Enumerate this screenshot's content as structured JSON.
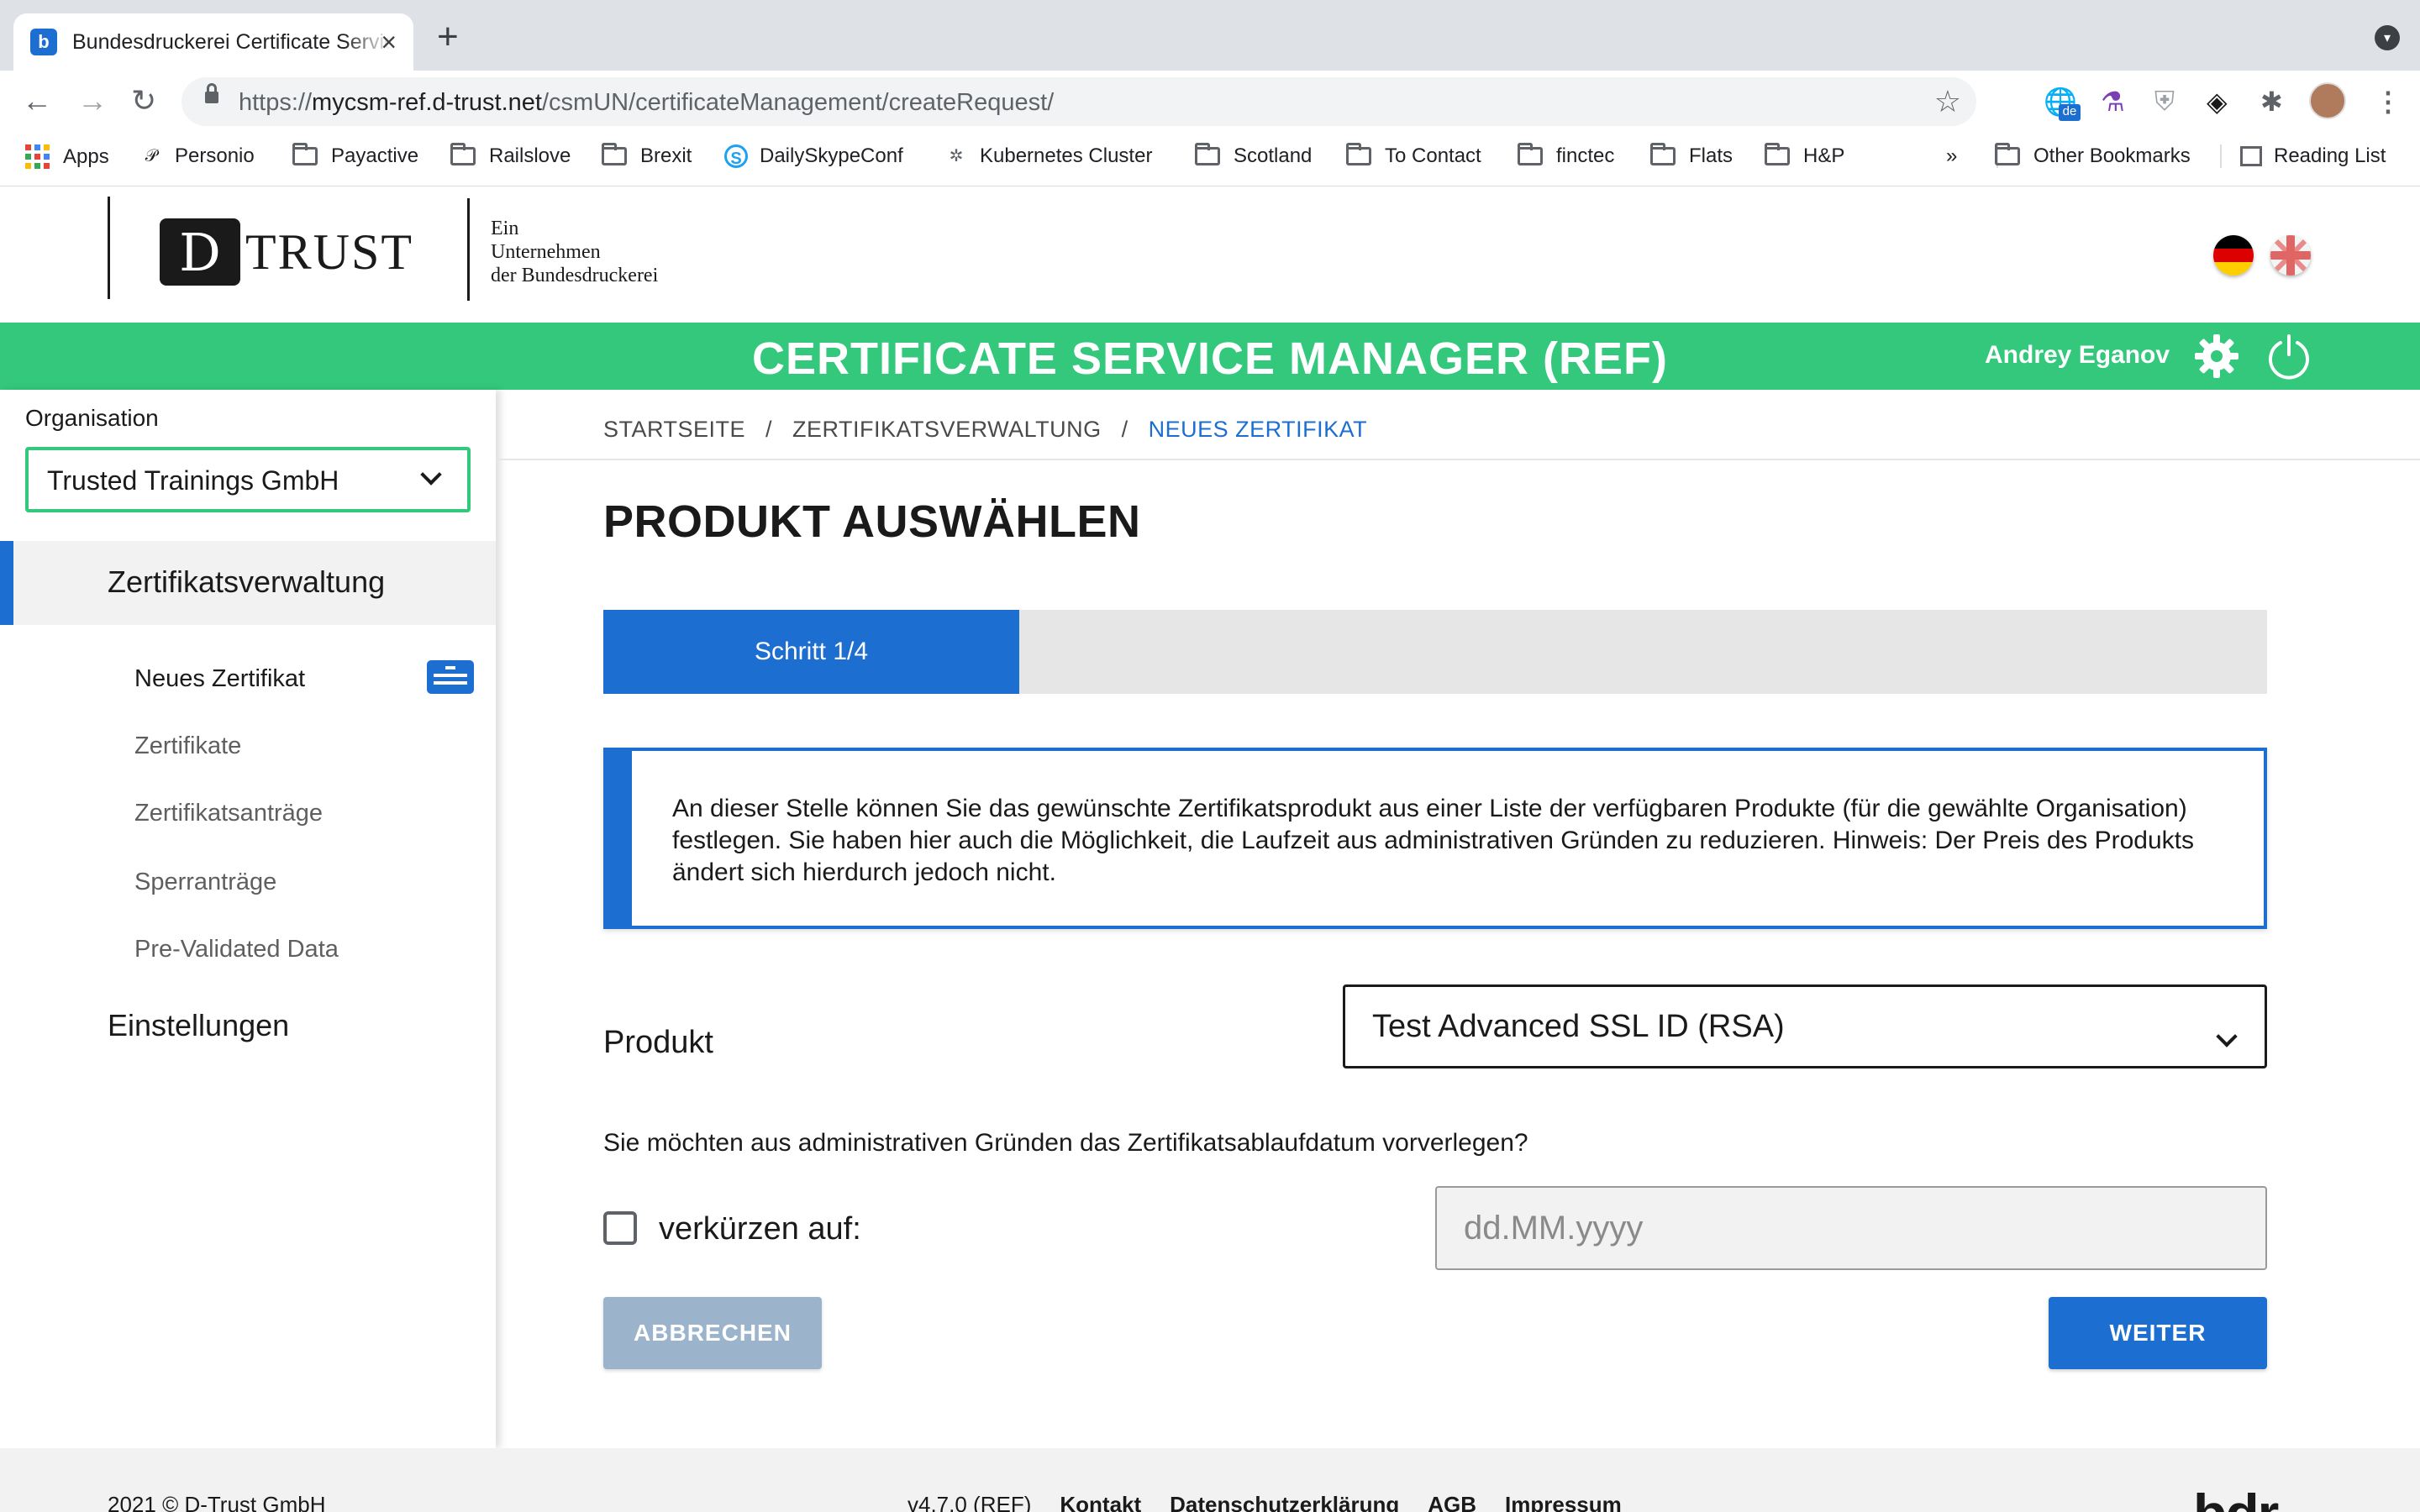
{
  "browser": {
    "tab_title": "Bundesdruckerei Certificate Service Manager",
    "favicon_letter": "b",
    "url_prefix": "https://",
    "url_host": "mycsm-ref.d-trust.net",
    "url_path": "/csmUN/certificateManagement/createRequest/",
    "profile_lang_badge": "de",
    "bookmarks": [
      {
        "label": "Apps",
        "icon": "apps-grid-icon"
      },
      {
        "label": "Personio",
        "icon": "personio-icon"
      },
      {
        "label": "Payactive",
        "icon": "folder-icon"
      },
      {
        "label": "Railslove",
        "icon": "folder-icon"
      },
      {
        "label": "Brexit",
        "icon": "folder-icon"
      },
      {
        "label": "DailySkypeConf",
        "icon": "skype-icon"
      },
      {
        "label": "Kubernetes Cluster",
        "icon": "kubernetes-icon"
      },
      {
        "label": "Scotland",
        "icon": "folder-icon"
      },
      {
        "label": "To Contact",
        "icon": "folder-icon"
      },
      {
        "label": "finctec",
        "icon": "folder-icon"
      },
      {
        "label": "Flats",
        "icon": "folder-icon"
      },
      {
        "label": "H&P",
        "icon": "folder-icon"
      }
    ],
    "bookmarks_overflow": "»",
    "other_bookmarks": "Other Bookmarks",
    "reading_list": "Reading List"
  },
  "header": {
    "logo_mark": "D",
    "logo_text": "TRUST",
    "logo_sub_1": "Ein",
    "logo_sub_2": "Unternehmen",
    "logo_sub_3": "der Bundesdruckerei",
    "languages": [
      "de",
      "en"
    ]
  },
  "banner": {
    "title": "CERTIFICATE SERVICE MANAGER (REF)",
    "user_name": "Andrey Eganov",
    "color": "#33c87c"
  },
  "sidebar": {
    "org_label": "Organisation",
    "org_value": "Trusted Trainings GmbH",
    "main_item": "Zertifikatsverwaltung",
    "sub_items": [
      {
        "label": "Neues Zertifikat",
        "active": true
      },
      {
        "label": "Zertifikate"
      },
      {
        "label": "Zertifikatsanträge"
      },
      {
        "label": "Sperranträge"
      },
      {
        "label": "Pre-Validated Data"
      }
    ],
    "settings": "Einstellungen"
  },
  "breadcrumb": [
    "STARTSEITE",
    "ZERTIFIKATSVERWALTUNG",
    "NEUES ZERTIFIKAT"
  ],
  "breadcrumb_separator": "/",
  "main": {
    "title": "PRODUKT AUSWÄHLEN",
    "step_label": "Schritt 1/4",
    "step_progress": 0.25,
    "info_text": "An dieser Stelle können Sie das gewünschte Zertifikatsprodukt aus einer Liste der verfügbaren Produkte (für die gewählte Organisation) festlegen. Sie haben hier auch die Möglichkeit, die Laufzeit aus administrativen Gründen zu reduzieren. Hinweis: Der Preis des Produkts ändert sich hierdurch jedoch nicht.",
    "product_label": "Produkt",
    "product_value": "Test Advanced SSL ID (RSA)",
    "question": "Sie möchten aus administrativen Gründen das Zertifikatsablaufdatum vorverlegen?",
    "shorten_label": "verkürzen auf:",
    "shorten_checked": false,
    "date_placeholder": "dd.MM.yyyy",
    "cancel_button": "ABBRECHEN",
    "next_button": "WEITER",
    "accent_color": "#1c6ed1"
  },
  "footer": {
    "copyright": "2021 © D-Trust GmbH",
    "version": "v4.7.0 (REF)",
    "links": [
      "Kontakt",
      "Datenschutzerklärung",
      "AGB",
      "Impressum"
    ],
    "brand": "bdr"
  }
}
